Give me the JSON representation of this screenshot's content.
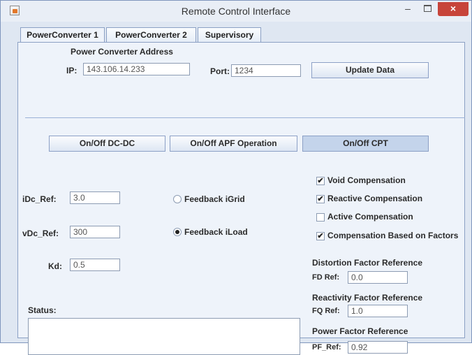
{
  "window": {
    "title": "Remote Control Interface",
    "minimize": "–",
    "close": "×"
  },
  "tabs": [
    {
      "label": "PowerConverter 1",
      "active": true
    },
    {
      "label": "PowerConverter 2",
      "active": false
    },
    {
      "label": "Supervisory",
      "active": false
    }
  ],
  "address": {
    "heading": "Power Converter Address",
    "ip_label": "IP:",
    "ip_value": "143.106.14.233",
    "port_label": "Port:",
    "port_value": "1234",
    "update_button": "Update Data"
  },
  "controls": {
    "dcdc_button": "On/Off  DC-DC",
    "apf_button": "On/Off  APF Operation",
    "cpt_button": "On/Off CPT"
  },
  "refs": {
    "idc_label": "iDc_Ref:",
    "idc_value": "3.0",
    "vdc_label": "vDc_Ref:",
    "vdc_value": "300",
    "kd_label": "Kd:",
    "kd_value": "0.5"
  },
  "feedback": [
    {
      "label": "Feedback iGrid",
      "selected": false
    },
    {
      "label": "Feedback iLoad",
      "selected": true
    }
  ],
  "compensation": [
    {
      "label": "Void Compensation",
      "checked": true
    },
    {
      "label": "Reactive Compensation",
      "checked": true
    },
    {
      "label": "Active Compensation",
      "checked": false
    },
    {
      "label": "Compensation Based on Factors",
      "checked": true
    }
  ],
  "factors": {
    "distortion_heading": "Distortion Factor Reference",
    "fd_label": "FD Ref:",
    "fd_value": "0.0",
    "reactivity_heading": "Reactivity Factor Reference",
    "fq_label": "FQ Ref:",
    "fq_value": "1.0",
    "power_heading": "Power Factor Reference",
    "pf_label": "PF_Ref:",
    "pf_value": "0.92"
  },
  "status": {
    "label": "Status:",
    "value": ""
  },
  "icons": {
    "app": "java-cup-icon",
    "check_mark": "✔"
  }
}
